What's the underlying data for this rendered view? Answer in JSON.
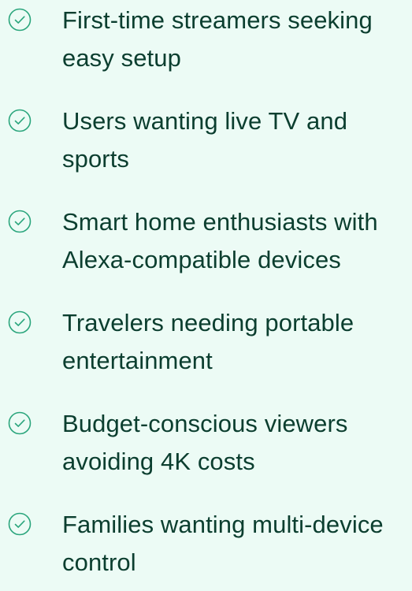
{
  "checklist": {
    "accent_color": "#2aa57c",
    "text_color": "#0b3e2f",
    "background_color": "#ecfbf5",
    "icon": "check-circle-icon",
    "items": [
      {
        "label": "First-time streamers seeking easy setup"
      },
      {
        "label": "Users wanting live TV and sports"
      },
      {
        "label": "Smart home enthusiasts with Alexa-compatible devices"
      },
      {
        "label": "Travelers needing portable entertainment"
      },
      {
        "label": "Budget-conscious viewers avoiding 4K costs"
      },
      {
        "label": "Families wanting multi-device control"
      }
    ]
  }
}
